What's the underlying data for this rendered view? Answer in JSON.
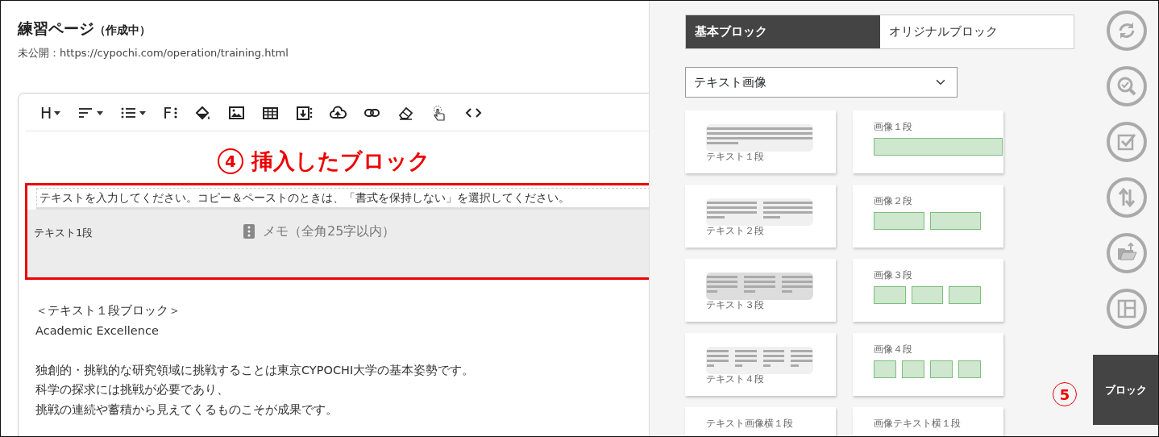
{
  "page": {
    "title": "練習ページ",
    "status": "（作成中）",
    "url_line": "未公開：https://cypochi.com/operation/training.html"
  },
  "editor": {
    "toolbar": [
      {
        "kind": "heading",
        "label": "H",
        "dropdown": true
      },
      {
        "kind": "align",
        "dropdown": true
      },
      {
        "kind": "list",
        "dropdown": true
      },
      {
        "kind": "font",
        "label": "F"
      },
      {
        "kind": "fill"
      },
      {
        "kind": "image"
      },
      {
        "kind": "table"
      },
      {
        "kind": "insert"
      },
      {
        "kind": "upload"
      },
      {
        "kind": "link"
      },
      {
        "kind": "eraser"
      },
      {
        "kind": "pointer"
      },
      {
        "kind": "code"
      }
    ],
    "annotation": {
      "number": "4",
      "text": "挿入したブロック"
    },
    "block": {
      "selected": true,
      "placeholder": "テキストを入力してください。コピー＆ペーストのときは、「書式を保持しない」を選択してください。",
      "label": "テキスト1段",
      "memo_placeholder": "メモ（全角25字以内）"
    },
    "paragraphs": [
      [
        "＜テキスト１段ブロック＞",
        "Academic Excellence"
      ],
      [
        "独創的・挑戦的な研究領域に挑戦することは東京CYPOCHI大学の基本姿勢です。",
        "科学の探求には挑戦が必要であり、",
        "挑戦の連続や蓄積から見えてくるものこそが成果です。"
      ]
    ]
  },
  "block_panel": {
    "tabs": [
      {
        "label": "基本ブロック",
        "selected": true
      },
      {
        "label": "オリジナルブロック",
        "selected": false
      }
    ],
    "category": "テキスト画像",
    "blocks": [
      {
        "label": "テキスト１段",
        "kind": "text1"
      },
      {
        "label": "画像１段",
        "kind": "image1"
      },
      {
        "label": "テキスト２段",
        "kind": "text2"
      },
      {
        "label": "画像２段",
        "kind": "image2"
      },
      {
        "label": "テキスト３段",
        "kind": "text3"
      },
      {
        "label": "画像３段",
        "kind": "image3"
      },
      {
        "label": "テキスト４段",
        "kind": "text4"
      },
      {
        "label": "画像４段",
        "kind": "image4"
      },
      {
        "label": "テキスト画像横１段",
        "kind": "textimage"
      },
      {
        "label": "画像テキスト横１段",
        "kind": "imagetext"
      }
    ]
  },
  "side_rail": {
    "tools": [
      {
        "kind": "refresh"
      },
      {
        "kind": "preview"
      },
      {
        "kind": "check"
      },
      {
        "kind": "sort"
      },
      {
        "kind": "folder"
      },
      {
        "kind": "layout"
      }
    ],
    "block_button": "ブロック",
    "annotation": "5"
  }
}
